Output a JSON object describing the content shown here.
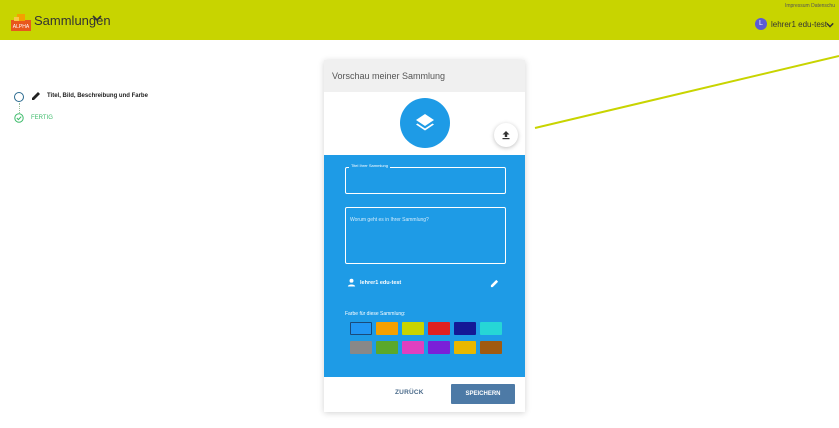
{
  "header": {
    "app_title": "Sammlungen",
    "imprint": "Impressum   Datenschu",
    "user_initial": "L",
    "user_name": "lehrer1 edu-test"
  },
  "stepper": {
    "step1_label": "Titel, Bild, Beschreibung und Farbe",
    "step2_label": "FERTIG"
  },
  "card": {
    "title": "Vorschau meiner Sammlung",
    "title_field_label": "Titel Ihrer Sammlung",
    "title_field_value": "",
    "description_placeholder": "Worum geht es in Ihrer Sammlung?",
    "owner_name": "lehrer1 edu-test",
    "color_label": "Farbe für diese Sammlung:",
    "back_label": "ZURÜCK",
    "save_label": "SPEICHERN"
  },
  "colors": {
    "topbar": "#c8d400",
    "panel": "#1e9be6",
    "swatches_row1": [
      "#2196f3",
      "#f5a000",
      "#c8d400",
      "#e02020",
      "#141896",
      "#26d6d6"
    ],
    "swatches_row2": [
      "#888888",
      "#5aa82a",
      "#e040c0",
      "#7a20d8",
      "#e8b800",
      "#a05a10"
    ]
  }
}
